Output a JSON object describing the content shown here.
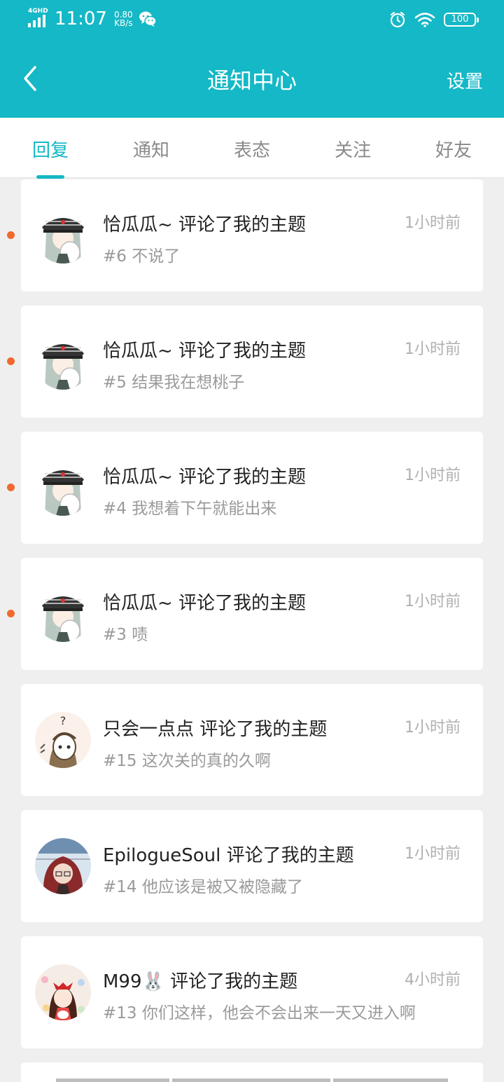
{
  "status_bar": {
    "network": "4GHD",
    "time": "11:07",
    "speed_value": "0.80",
    "speed_unit": "KB/s",
    "battery": "100",
    "icons": [
      "signal-icon",
      "wechat-icon",
      "alarm-icon",
      "wifi-icon",
      "battery-icon"
    ]
  },
  "header": {
    "title": "通知中心",
    "settings_label": "设置",
    "back_icon": "back-arrow-icon"
  },
  "tabs": [
    {
      "label": "回复",
      "active": true
    },
    {
      "label": "通知",
      "active": false
    },
    {
      "label": "表态",
      "active": false
    },
    {
      "label": "关注",
      "active": false
    },
    {
      "label": "好友",
      "active": false
    }
  ],
  "notifications": [
    {
      "title": "恰瓜瓜~ 评论了我的主题",
      "subtitle": "#6 不说了",
      "time": "1小时前",
      "unread": true,
      "avatar": "avatar-anime-cap"
    },
    {
      "title": "恰瓜瓜~ 评论了我的主题",
      "subtitle": "#5 结果我在想桃子",
      "time": "1小时前",
      "unread": true,
      "avatar": "avatar-anime-cap"
    },
    {
      "title": "恰瓜瓜~ 评论了我的主题",
      "subtitle": "#4 我想着下午就能出来",
      "time": "1小时前",
      "unread": true,
      "avatar": "avatar-anime-cap"
    },
    {
      "title": "恰瓜瓜~ 评论了我的主题",
      "subtitle": "#3 啧",
      "time": "1小时前",
      "unread": true,
      "avatar": "avatar-anime-cap"
    },
    {
      "title": "只会一点点 评论了我的主题",
      "subtitle": "#15 这次关的真的久啊",
      "time": "1小时前",
      "unread": false,
      "avatar": "avatar-question-sketch"
    },
    {
      "title": "EpilogueSoul 评论了我的主题",
      "subtitle": "#14 他应该是被又被隐藏了",
      "time": "1小时前",
      "unread": false,
      "avatar": "avatar-red-hair"
    },
    {
      "title": "M99🐰 评论了我的主题",
      "subtitle": "#13 你们这样，他会不会出来一天又进入啊",
      "time": "4小时前",
      "unread": false,
      "avatar": "avatar-shrine-girl"
    }
  ],
  "colors": {
    "accent": "#15b8c6",
    "unread_dot": "#f06a2e",
    "background": "#efefef",
    "card": "#ffffff"
  }
}
